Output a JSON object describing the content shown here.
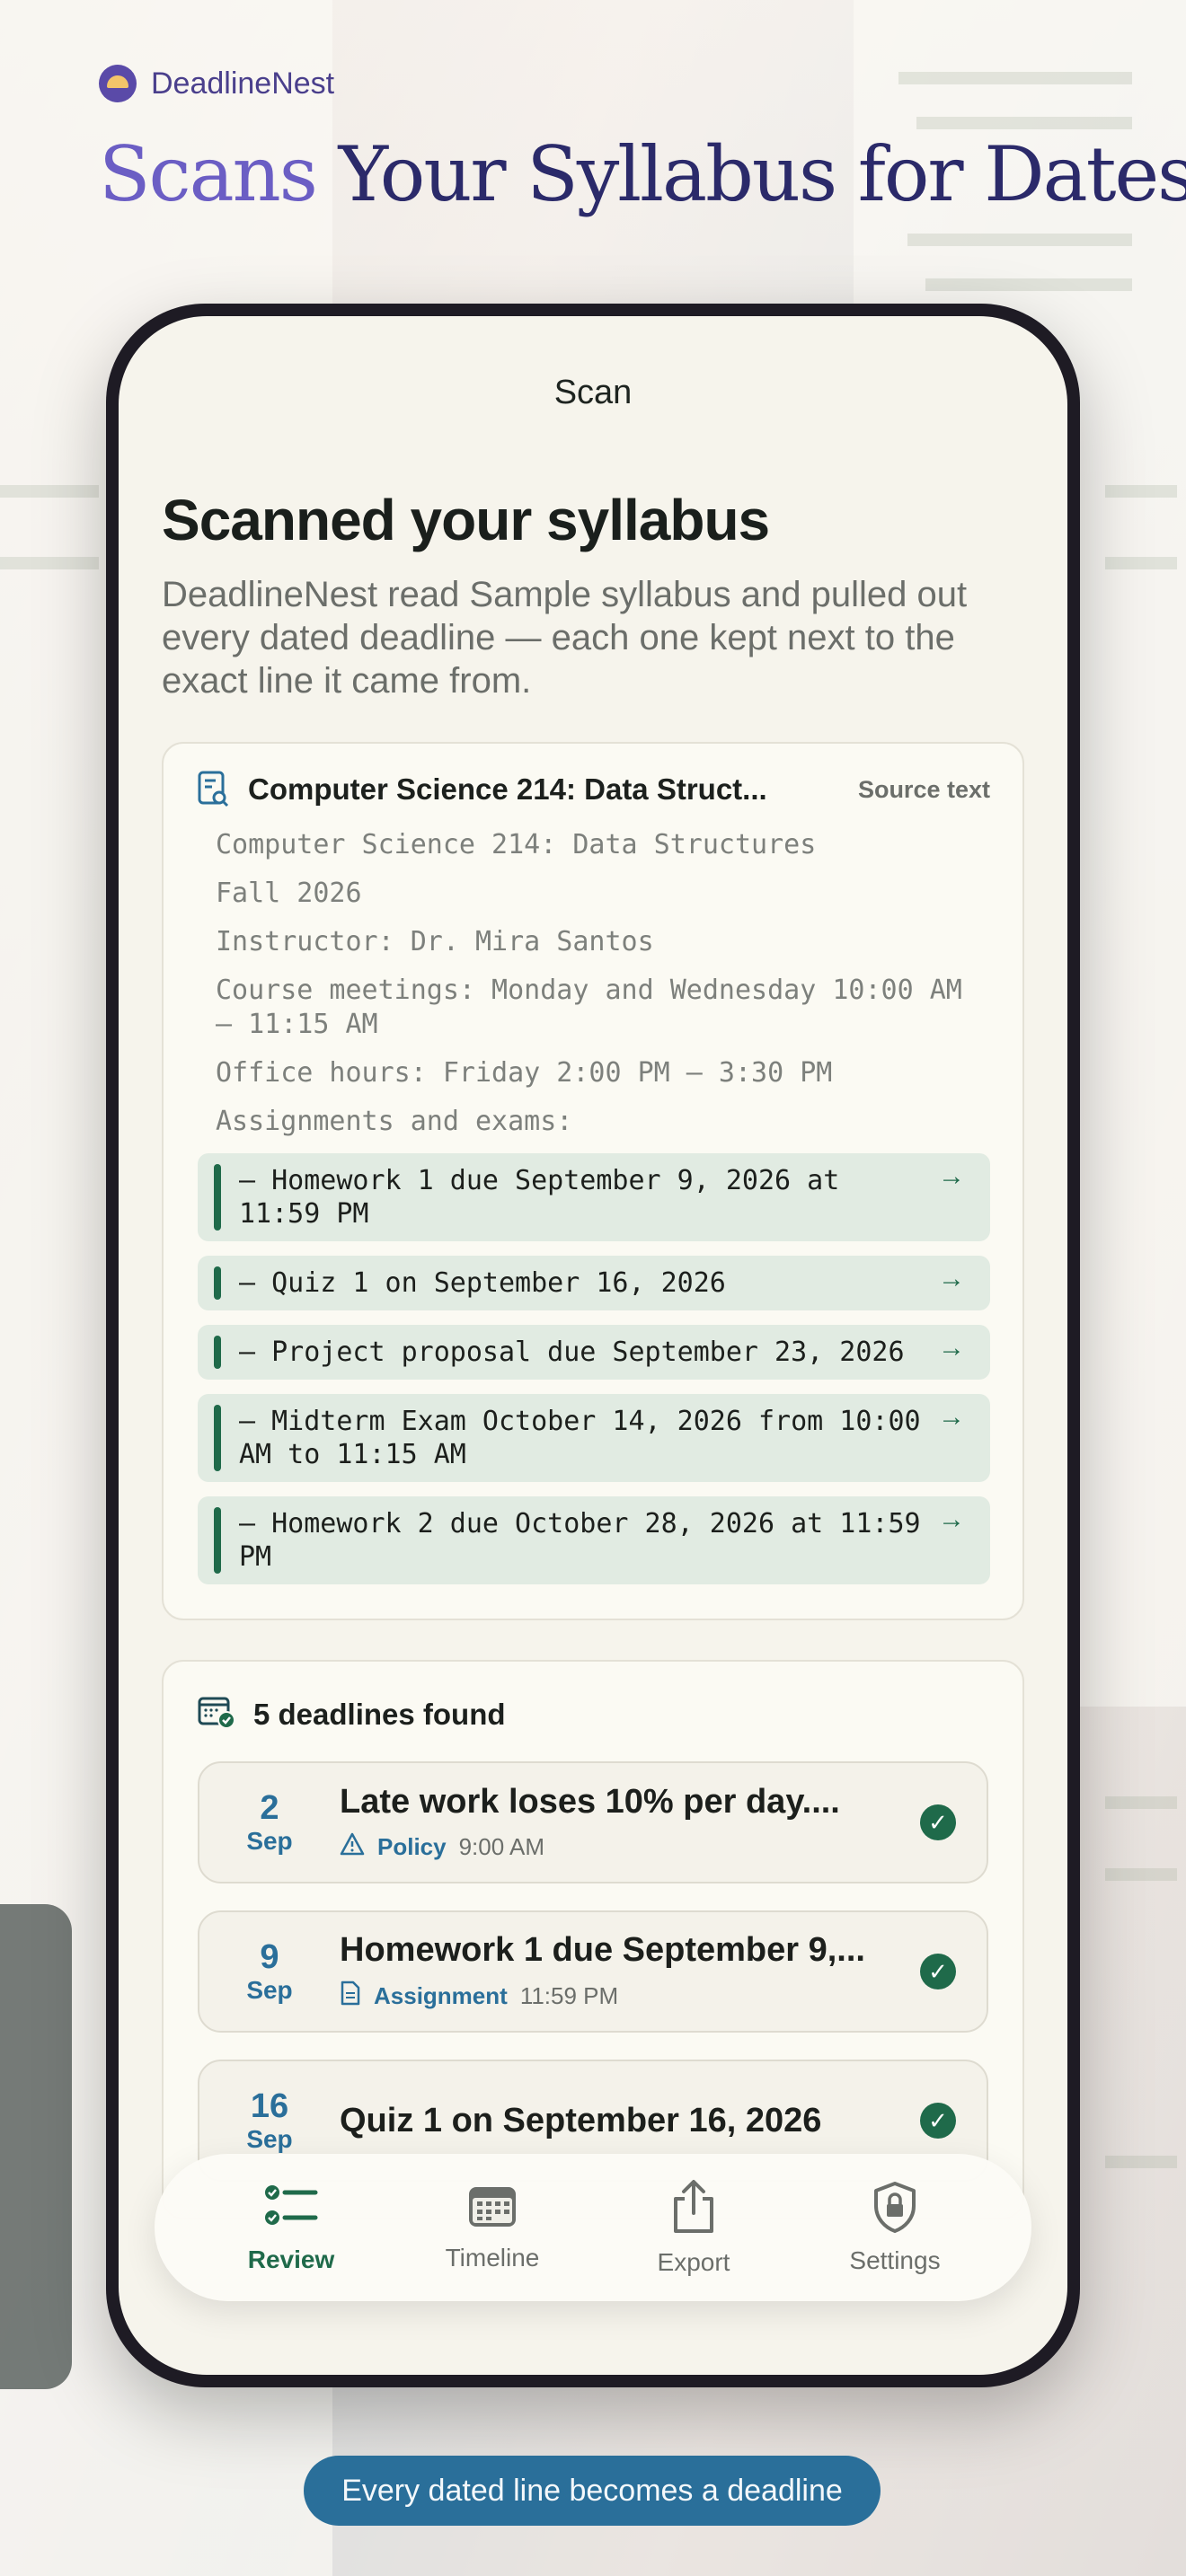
{
  "brand": {
    "name": "DeadlineNest"
  },
  "headline": {
    "accent": "Scans",
    "rest": "Your Syllabus for Dates"
  },
  "nav": {
    "title": "Scan"
  },
  "main": {
    "heading": "Scanned your syllabus",
    "intro": "DeadlineNest read Sample syllabus and pulled out every dated deadline — each one kept next to the exact line it came from."
  },
  "source_card": {
    "title": "Computer Science 214: Data Struct...",
    "tag": "Source text",
    "lines": [
      "Computer Science 214: Data Structures",
      "Fall 2026",
      "Instructor: Dr. Mira Santos",
      "Course meetings: Monday and Wednesday 10:00 AM – 11:15 AM",
      "Office hours: Friday 2:00 PM – 3:30 PM",
      "Assignments and exams:"
    ],
    "highlights": [
      "– Homework 1 due September 9, 2026 at 11:59 PM",
      "– Quiz 1 on September 16, 2026",
      "– Project proposal due September 23, 2026",
      "– Midterm Exam October 14, 2026 from 10:00 AM to 11:15 AM",
      "– Homework 2 due October 28, 2026 at 11:59 PM"
    ],
    "arrow": "→"
  },
  "deadlines": {
    "title": "5 deadlines found",
    "items": [
      {
        "day": "2",
        "month": "Sep",
        "name": "Late work loses 10% per day....",
        "kind": "Policy",
        "kind_icon": "warning-icon",
        "time": "9:00 AM",
        "check": "✓"
      },
      {
        "day": "9",
        "month": "Sep",
        "name": "Homework 1 due September 9,...",
        "kind": "Assignment",
        "kind_icon": "document-icon",
        "time": "11:59 PM",
        "check": "✓"
      },
      {
        "day": "16",
        "month": "Sep",
        "name": "Quiz 1 on September 16, 2026",
        "kind": "",
        "kind_icon": "",
        "time": "",
        "check": "✓"
      }
    ]
  },
  "tabs": [
    {
      "label": "Review",
      "icon": "checklist-icon",
      "active": true
    },
    {
      "label": "Timeline",
      "icon": "calendar-icon",
      "active": false
    },
    {
      "label": "Export",
      "icon": "share-icon",
      "active": false
    },
    {
      "label": "Settings",
      "icon": "lock-shield-icon",
      "active": false
    }
  ],
  "caption": "Every dated line becomes a deadline",
  "colors": {
    "accent_green": "#1f6a4a",
    "accent_blue": "#2a6f9a",
    "brand_purple": "#6b5ec4"
  }
}
